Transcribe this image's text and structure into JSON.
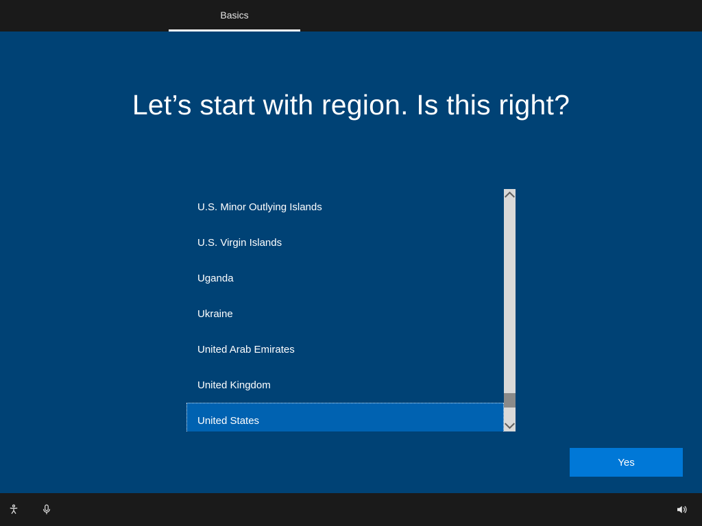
{
  "tabs": {
    "active": "Basics"
  },
  "heading": "Let’s start with region. Is this right?",
  "regions": [
    "U.S. Minor Outlying Islands",
    "U.S. Virgin Islands",
    "Uganda",
    "Ukraine",
    "United Arab Emirates",
    "United Kingdom",
    "United States"
  ],
  "selected_region_index": 6,
  "buttons": {
    "confirm": "Yes"
  },
  "icons": {
    "accessibility": "accessibility-icon",
    "microphone": "microphone-icon",
    "volume": "volume-icon"
  }
}
